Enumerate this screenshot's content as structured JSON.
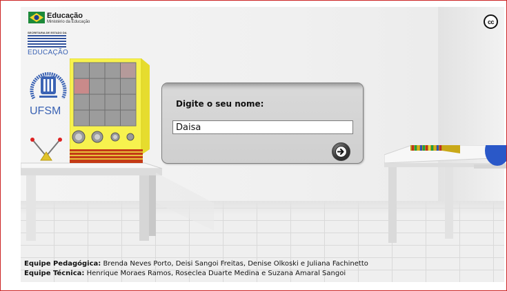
{
  "logos": {
    "edu_title": "Educação",
    "edu_subtitle": "Ministério da Educação",
    "secretaria_tiny": "SECRETARIA DE ESTADO DA",
    "secretaria_word": "EDUCAÇÃO",
    "ufsm_word": "UFSM",
    "ufsm_seal_text": "Universidade Federal de Santa Maria"
  },
  "cc_icon": {
    "label": "cc"
  },
  "dialog": {
    "label": "Digite o seu nome:",
    "name_value": "Daisa",
    "next_icon": "arrow-right-icon"
  },
  "credits": {
    "pedagogica_label": "Equipe Pedagógica:",
    "pedagogica_names": " Brenda Neves Porto, Deisi Sangoi Freitas, Denise Olkoski e Juliana Fachinetto",
    "tecnica_label": "Equipe Técnica:",
    "tecnica_names": " Henrique Moraes Ramos, Roseclea Duarte Medina e Suzana Amaral Sangoi"
  },
  "colors": {
    "frame_border": "#cc2222",
    "machine_yellow": "#f3ea4a",
    "logo_blue": "#3b63b4"
  }
}
